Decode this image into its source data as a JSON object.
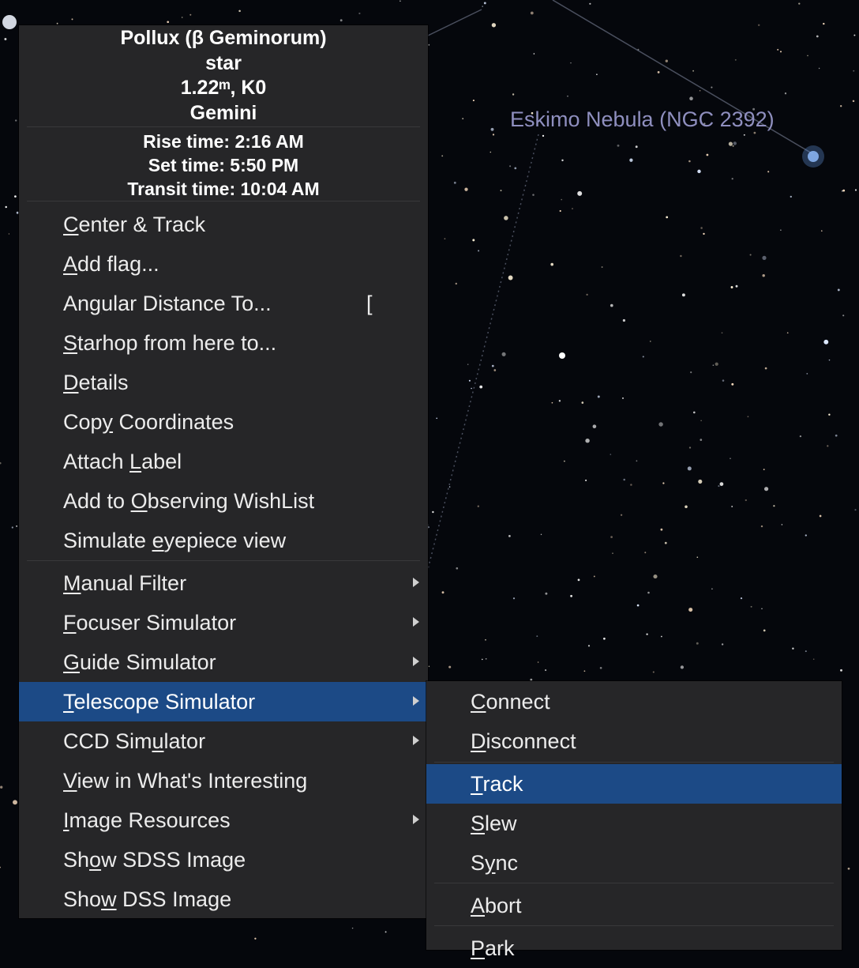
{
  "sky": {
    "nebula_label": "Eskimo Nebula (NGC 2392)"
  },
  "popup": {
    "object_name": "Pollux (β Geminorum)",
    "object_type": "star",
    "magnitude_spectral": "1.22ᵐ, K0",
    "constellation": "Gemini",
    "rise_time": "Rise time: 2:16 AM",
    "set_time": "Set time: 5:50 PM",
    "transit_time": "Transit time: 10:04 AM",
    "items": [
      {
        "pre": "",
        "u": "C",
        "post": "enter & Track"
      },
      {
        "pre": "",
        "u": "A",
        "post": "dd flag..."
      },
      {
        "pre": "An",
        "u": "g",
        "post": "ular Distance To...",
        "shortcut": "["
      },
      {
        "pre": "",
        "u": "S",
        "post": "tarhop from here to..."
      },
      {
        "pre": "",
        "u": "D",
        "post": "etails"
      },
      {
        "pre": "Cop",
        "u": "y",
        "post": " Coordinates"
      },
      {
        "pre": "Attach ",
        "u": "L",
        "post": "abel"
      },
      {
        "pre": "Add to ",
        "u": "O",
        "post": "bserving WishList"
      },
      {
        "pre": "Simulate ",
        "u": "e",
        "post": "yepiece view"
      }
    ],
    "device_items": [
      {
        "pre": "",
        "u": "M",
        "post": "anual Filter"
      },
      {
        "pre": "",
        "u": "F",
        "post": "ocuser Simulator"
      },
      {
        "pre": "",
        "u": "G",
        "post": "uide Simulator"
      },
      {
        "pre": "",
        "u": "T",
        "post": "elescope Simulator"
      },
      {
        "pre": "CCD Sim",
        "u": "u",
        "post": "lator"
      },
      {
        "pre": "",
        "u": "V",
        "post": "iew in What's Interesting"
      },
      {
        "pre": "",
        "u": "I",
        "post": "mage Resources"
      },
      {
        "pre": "Sh",
        "u": "o",
        "post": "w SDSS Image"
      },
      {
        "pre": "Sho",
        "u": "w",
        "post": " DSS Image"
      }
    ]
  },
  "submenu": {
    "items": [
      {
        "pre": "",
        "u": "C",
        "post": "onnect"
      },
      {
        "pre": "",
        "u": "D",
        "post": "isconnect"
      },
      {
        "pre": "",
        "u": "T",
        "post": "rack"
      },
      {
        "pre": "",
        "u": "S",
        "post": "lew"
      },
      {
        "pre": "S",
        "u": "y",
        "post": "nc"
      },
      {
        "pre": "",
        "u": "A",
        "post": "bort"
      },
      {
        "pre": "",
        "u": "P",
        "post": "ark"
      }
    ]
  },
  "colors": {
    "menu_background": "#262628",
    "highlight": "#1c4a86",
    "nebula_label": "#8f8fbf"
  }
}
